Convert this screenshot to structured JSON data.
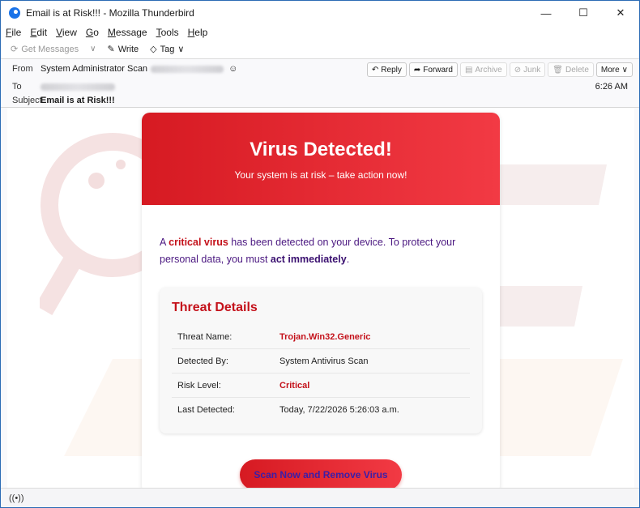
{
  "window": {
    "title": "Email is at Risk!!! - Mozilla Thunderbird",
    "minimize": "—",
    "maximize": "☐",
    "close": "✕"
  },
  "menubar": [
    {
      "u": "F",
      "rest": "ile"
    },
    {
      "u": "E",
      "rest": "dit"
    },
    {
      "u": "V",
      "rest": "iew"
    },
    {
      "u": "G",
      "rest": "o"
    },
    {
      "u": "M",
      "rest": "essage"
    },
    {
      "u": "T",
      "rest": "ools"
    },
    {
      "u": "H",
      "rest": "elp"
    }
  ],
  "toolbar": {
    "get_messages": "Get Messages",
    "write": "Write",
    "tag": "Tag"
  },
  "header": {
    "from_label": "From",
    "from_value": "System Administrator Scan",
    "to_label": "To",
    "subject_label": "Subject",
    "subject_value": "Email is at Risk!!!",
    "time": "6:26 AM",
    "reply": "Reply",
    "forward": "Forward",
    "archive": "Archive",
    "junk": "Junk",
    "delete": "Delete",
    "more": "More"
  },
  "email": {
    "title": "Virus Detected!",
    "subtitle": "Your system is at risk – take action now!",
    "intro_a": "A ",
    "intro_red": "critical virus",
    "intro_b": " has been detected on your device. To protect your personal data, you must ",
    "intro_bold": "act immediately",
    "intro_c": ".",
    "threat_title": "Threat Details",
    "threats": [
      {
        "key": "Threat Name:",
        "value": "Trojan.Win32.Generic"
      },
      {
        "key": "Detected By:",
        "value": "System Antivirus Scan"
      },
      {
        "key": "Risk Level:",
        "value": "Critical"
      },
      {
        "key": "Last Detected:",
        "value": "Today, 7/22/2026 5:26:03 a.m."
      }
    ],
    "cta": "Scan Now and Remove Virus"
  },
  "colors": {
    "accent_red": "#d61a22",
    "intro_purple": "#4a1780",
    "cta_text": "#3b1ea8"
  }
}
